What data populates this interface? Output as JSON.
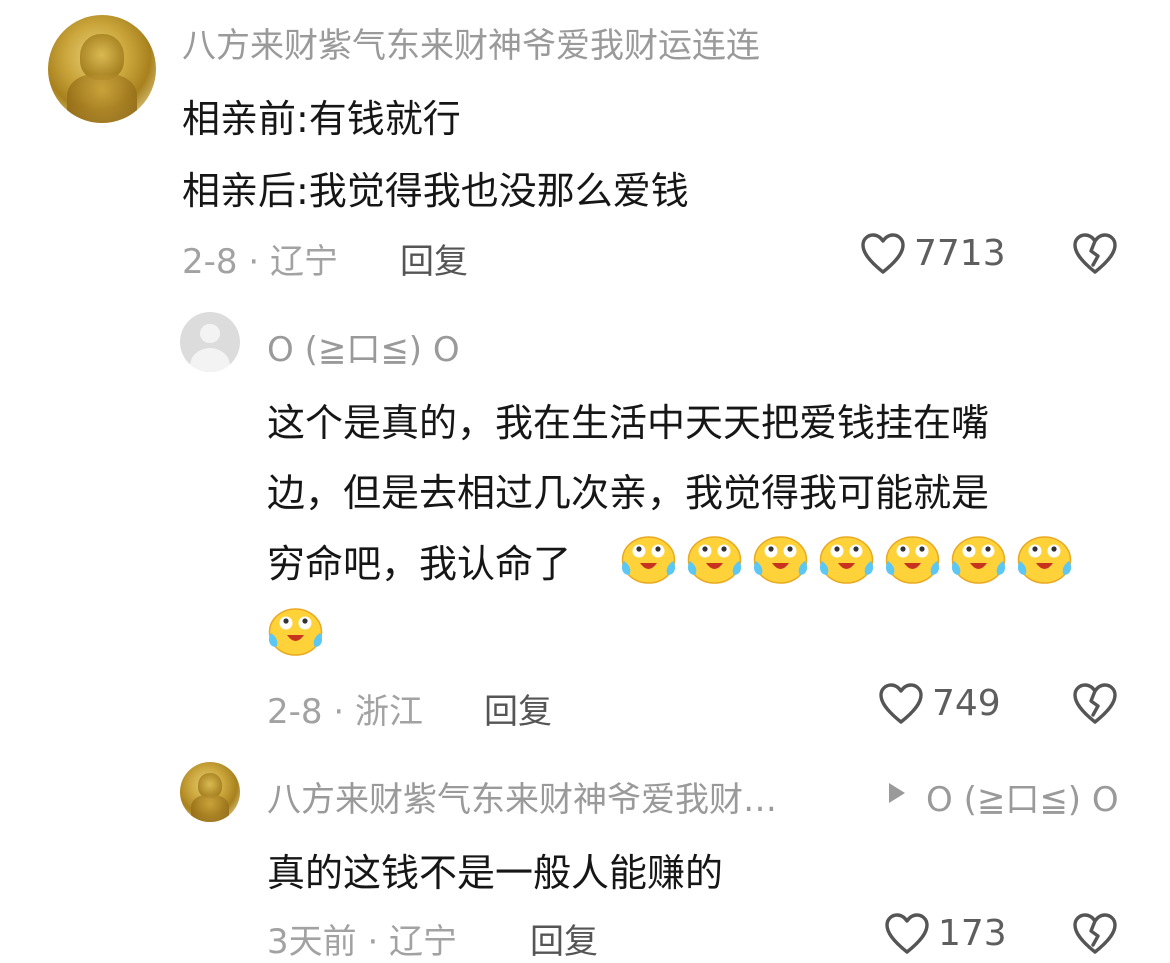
{
  "comments": [
    {
      "author": "八方来财紫气东来财神爷爱我财运连连",
      "lines": [
        "相亲前:有钱就行",
        "相亲后:我觉得我也没那么爱钱"
      ],
      "meta": "2-8 · 辽宁",
      "reply_label": "回复",
      "likes": "7713"
    },
    {
      "author": "O (≧口≦) O",
      "lines": [
        "这个是真的，我在生活中天天把爱钱挂在嘴",
        "边，但是去相过几次亲，我觉得我可能就是",
        "穷命吧，我认命了"
      ],
      "emoji_count": 8,
      "meta": "2-8 · 浙江",
      "reply_label": "回复",
      "likes": "749"
    },
    {
      "author": "八方来财紫气东来财神爷爱我财…",
      "reply_to": "O (≧口≦) O",
      "lines": [
        "真的这钱不是一般人能赚的"
      ],
      "meta": "3天前 · 辽宁",
      "reply_label": "回复",
      "likes": "173"
    }
  ],
  "icons": {
    "like": "heart-outline-icon",
    "dislike": "broken-heart-icon",
    "reply_arrow": "play-triangle-icon",
    "emoji": "crying-laughing-face-emoji"
  },
  "colors": {
    "text": "#161616",
    "secondary": "#9a9a9a",
    "icon": "#555555"
  }
}
